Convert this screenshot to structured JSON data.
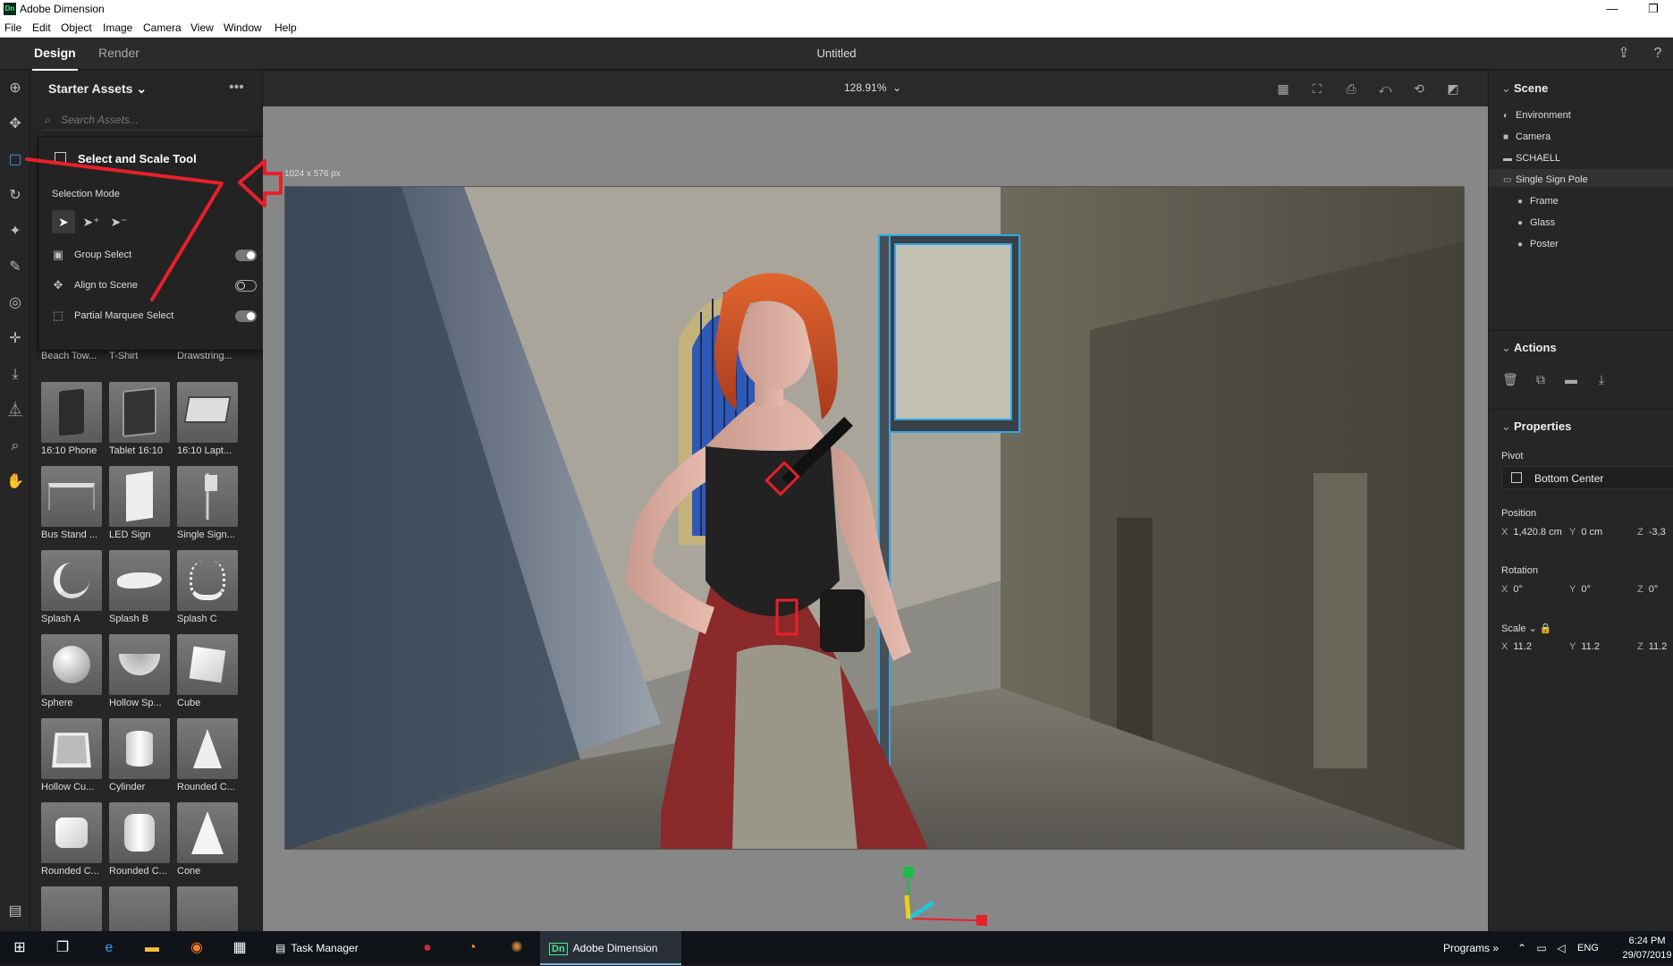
{
  "window": {
    "app_title": "Adobe Dimension",
    "logo_text": "Dn",
    "minimize": "—",
    "restore": "❐"
  },
  "menu": [
    "File",
    "Edit",
    "Object",
    "Image",
    "Camera",
    "View",
    "Window",
    "Help"
  ],
  "header": {
    "tab_design": "Design",
    "tab_render": "Render",
    "document_title": "Untitled"
  },
  "assets": {
    "title": "Starter Assets",
    "search_placeholder": "Search Assets...",
    "items": [
      {
        "label": "Beach Tow..."
      },
      {
        "label": "T-Shirt"
      },
      {
        "label": "Drawstring..."
      },
      {
        "label": "16:10 Phone"
      },
      {
        "label": "Tablet 16:10"
      },
      {
        "label": "16:10 Lapt..."
      },
      {
        "label": "Bus Stand ..."
      },
      {
        "label": "LED Sign"
      },
      {
        "label": "Single Sign..."
      },
      {
        "label": "Splash A"
      },
      {
        "label": "Splash B"
      },
      {
        "label": "Splash C"
      },
      {
        "label": "Sphere"
      },
      {
        "label": "Hollow Sp..."
      },
      {
        "label": "Cube"
      },
      {
        "label": "Hollow Cu..."
      },
      {
        "label": "Cylinder"
      },
      {
        "label": "Rounded C..."
      },
      {
        "label": "Rounded C..."
      },
      {
        "label": "Rounded C..."
      },
      {
        "label": "Cone"
      }
    ]
  },
  "tool_panel": {
    "title": "Select and Scale Tool",
    "selection_mode": "Selection Mode",
    "options": [
      {
        "label": "Group Select",
        "state": "on"
      },
      {
        "label": "Align to Scene",
        "state": "off"
      },
      {
        "label": "Partial Marquee Select",
        "state": "on"
      }
    ]
  },
  "viewport": {
    "zoom": "128.91%",
    "canvas_size": "1024 x 576 px"
  },
  "scene": {
    "title": "Scene",
    "items": [
      {
        "label": "Environment",
        "icon": "environment-icon"
      },
      {
        "label": "Camera",
        "icon": "camera-icon"
      },
      {
        "label": "SCHAELL",
        "icon": "folder-icon"
      },
      {
        "label": "Single Sign Pole",
        "icon": "folder-open-icon"
      },
      {
        "label": "Frame",
        "icon": "material-icon"
      },
      {
        "label": "Glass",
        "icon": "material-icon"
      },
      {
        "label": "Poster",
        "icon": "material-icon"
      }
    ]
  },
  "actions": {
    "title": "Actions"
  },
  "properties": {
    "title": "Properties",
    "pivot_label": "Pivot",
    "pivot_value": "Bottom Center",
    "position_label": "Position",
    "position": {
      "x": "1,420.8 cm",
      "y": "0 cm",
      "z": "-3,3"
    },
    "rotation_label": "Rotation",
    "rotation": {
      "x": "0°",
      "y": "0°",
      "z": "0°"
    },
    "scale_label": "Scale",
    "scale": {
      "x": "11.2",
      "y": "11.2",
      "z": "11.2"
    }
  },
  "taskbar": {
    "apps": [
      {
        "label": "Task Manager"
      },
      {
        "label": "Adobe Dimension"
      }
    ],
    "programs": "Programs",
    "lang": "ENG",
    "time": "6:24 PM",
    "date": "29/07/2019"
  },
  "colors": {
    "accent": "#3d9be9",
    "annotation": "#e8202a",
    "sign_outline": "#2fa7e6"
  }
}
